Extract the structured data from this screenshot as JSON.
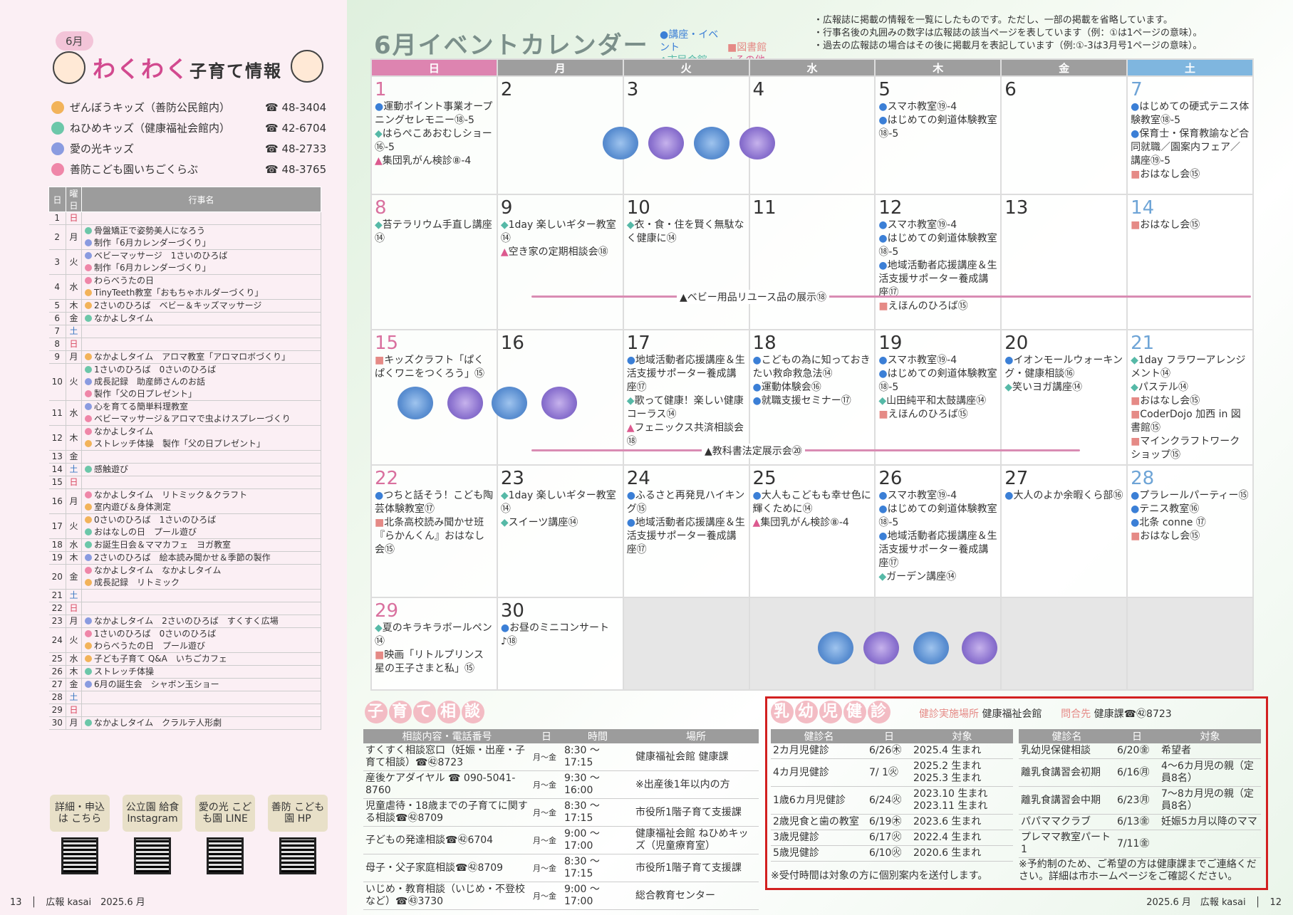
{
  "left": {
    "month_tag": "6月",
    "title_main": "わくわく",
    "title_sub": "子育て情報",
    "kids": [
      {
        "name": "ぜんぼうキッズ（善防公民館内）",
        "tel": "☎ 48-3404",
        "color": "#f2b35a"
      },
      {
        "name": "ねひめキッズ（健康福祉会館内）",
        "tel": "☎ 42-6704",
        "color": "#6cc7a9"
      },
      {
        "name": "愛の光キッズ",
        "tel": "☎ 48-2733",
        "color": "#8a9be0"
      },
      {
        "name": "善防こども園いちごくらぶ",
        "tel": "☎ 48-3765",
        "color": "#ef86a8"
      }
    ],
    "table_headers": [
      "日",
      "曜日",
      "行事名"
    ],
    "events": [
      {
        "d": "1",
        "w": "日",
        "n": ""
      },
      {
        "d": "2",
        "w": "月",
        "n": "骨盤矯正で姿勢美人になろう／制作「6月カレンダーづくり」"
      },
      {
        "d": "3",
        "w": "火",
        "n": "ベビーマッサージ　1さいのひろば／制作「6月カレンダーづくり」"
      },
      {
        "d": "4",
        "w": "水",
        "n": "わらべうたの日／TinyTeeth教室「おもちゃホルダーづくり」"
      },
      {
        "d": "5",
        "w": "木",
        "n": "2さいのひろば　ベビー＆キッズマッサージ"
      },
      {
        "d": "6",
        "w": "金",
        "n": "なかよしタイム"
      },
      {
        "d": "7",
        "w": "土",
        "n": ""
      },
      {
        "d": "8",
        "w": "日",
        "n": ""
      },
      {
        "d": "9",
        "w": "月",
        "n": "なかよしタイム　アロマ教室「アロマロボづくり」"
      },
      {
        "d": "10",
        "w": "火",
        "n": "1さいのひろば　0さいのひろば／成長記録　助産師さんのお話／製作「父の日プレゼント」"
      },
      {
        "d": "11",
        "w": "水",
        "n": "心を育てる簡単料理教室／ベビーマッサージ＆アロマで虫よけスプレーづくり"
      },
      {
        "d": "12",
        "w": "木",
        "n": "なかよしタイム／ストレッチ体操　製作「父の日プレゼント」"
      },
      {
        "d": "13",
        "w": "金",
        "n": ""
      },
      {
        "d": "14",
        "w": "土",
        "n": "感触遊び"
      },
      {
        "d": "15",
        "w": "日",
        "n": ""
      },
      {
        "d": "16",
        "w": "月",
        "n": "なかよしタイム　リトミック＆クラフト／室内遊び＆身体測定"
      },
      {
        "d": "17",
        "w": "火",
        "n": "0さいのひろば　1さいのひろば／おはなしの日　プール遊び"
      },
      {
        "d": "18",
        "w": "水",
        "n": "お誕生日会＆ママカフェ　ヨガ教室"
      },
      {
        "d": "19",
        "w": "木",
        "n": "2さいのひろば　絵本読み聞かせ＆季節の製作"
      },
      {
        "d": "20",
        "w": "金",
        "n": "なかよしタイム　なかよしタイム／成長記録　リトミック"
      },
      {
        "d": "21",
        "w": "土",
        "n": ""
      },
      {
        "d": "22",
        "w": "日",
        "n": ""
      },
      {
        "d": "23",
        "w": "月",
        "n": "なかよしタイム　2さいのひろば　すくすく広場"
      },
      {
        "d": "24",
        "w": "火",
        "n": "1さいのひろば　0さいのひろば／わらべうたの日　プール遊び"
      },
      {
        "d": "25",
        "w": "水",
        "n": "子ども子育て Q&A　いちごカフェ"
      },
      {
        "d": "26",
        "w": "木",
        "n": "ストレッチ体操"
      },
      {
        "d": "27",
        "w": "金",
        "n": "6月の誕生会　シャボン玉ショー"
      },
      {
        "d": "28",
        "w": "土",
        "n": ""
      },
      {
        "d": "29",
        "w": "日",
        "n": ""
      },
      {
        "d": "30",
        "w": "月",
        "n": "なかよしタイム　クラルテ人形劇"
      }
    ],
    "qr": [
      {
        "label": "詳細・申込は こちら"
      },
      {
        "label": "公立園 給食 Instagram"
      },
      {
        "label": "愛の光 こども園 LINE"
      },
      {
        "label": "善防 こども園 HP"
      }
    ],
    "footer": "13　│　広報 kasai　2025.6 月"
  },
  "calendar": {
    "title": "6月イベントカレンダー",
    "legend": [
      "●講座・イベント",
      "■図書館",
      "◆市民会館",
      "▲その他"
    ],
    "notes": [
      "・広報誌に掲載の情報を一覧にしたものです。ただし、一部の掲載を省略しています。",
      "・行事名後の丸囲みの数字は広報誌の該当ページを表しています（例：①は1ページの意味）。",
      "・過去の広報誌の場合はその後に掲載月を表記しています（例:①-3は3月号1ページの意味）。"
    ],
    "weekdays": [
      "日",
      "月",
      "火",
      "水",
      "木",
      "金",
      "土"
    ],
    "weeks": [
      [
        {
          "n": "1",
          "items": [
            [
              "●",
              "運動ポイント事業オープニングセレモニー⑱-5"
            ],
            [
              "◆",
              "はらぺこあおむしショー⑯-5"
            ],
            [
              "▲",
              "集団乳がん検診⑧-4"
            ]
          ]
        },
        {
          "n": "2",
          "items": []
        },
        {
          "n": "3",
          "items": []
        },
        {
          "n": "4",
          "items": []
        },
        {
          "n": "5",
          "items": [
            [
              "●",
              "スマホ教室⑲-4"
            ],
            [
              "●",
              "はじめての剣道体験教室⑱-5"
            ]
          ]
        },
        {
          "n": "6",
          "items": []
        },
        {
          "n": "7",
          "items": [
            [
              "●",
              "はじめての硬式テニス体験教室⑱-5"
            ],
            [
              "●",
              "保育士・保育教諭など合同就職／園案内フェア／講座⑲-5"
            ],
            [
              "■",
              "おはなし会⑮"
            ]
          ]
        }
      ],
      [
        {
          "n": "8",
          "items": [
            [
              "◆",
              "苔テラリウム手直し講座⑭"
            ]
          ]
        },
        {
          "n": "9",
          "items": [
            [
              "◆",
              "1day 楽しいギター教室⑭"
            ],
            [
              "▲",
              "空き家の定期相談会⑱"
            ]
          ]
        },
        {
          "n": "10",
          "items": [
            [
              "◆",
              "衣・食・住を賢く無駄なく健康に⑭"
            ]
          ]
        },
        {
          "n": "11",
          "items": []
        },
        {
          "n": "12",
          "items": [
            [
              "●",
              "スマホ教室⑲-4"
            ],
            [
              "●",
              "はじめての剣道体験教室⑱-5"
            ],
            [
              "●",
              "地域活動者応援講座＆生活支援サポーター養成講座⑰"
            ],
            [
              "■",
              "えほんのひろば⑮"
            ]
          ]
        },
        {
          "n": "13",
          "items": []
        },
        {
          "n": "14",
          "items": [
            [
              "■",
              "おはなし会⑮"
            ]
          ]
        }
      ],
      [
        {
          "n": "15",
          "items": [
            [
              "■",
              "キッズクラフト「ぱくぱくワニをつくろう」⑮"
            ]
          ]
        },
        {
          "n": "16",
          "items": []
        },
        {
          "n": "17",
          "items": [
            [
              "●",
              "地域活動者応援講座＆生活支援サポーター養成講座⑰"
            ],
            [
              "◆",
              "歌って健康！楽しい健康コーラス⑭"
            ],
            [
              "▲",
              "フェニックス共済相談会⑱"
            ]
          ]
        },
        {
          "n": "18",
          "items": [
            [
              "●",
              "こどもの為に知っておきたい救命救急法⑭"
            ],
            [
              "●",
              "運動体験会⑯"
            ],
            [
              "●",
              "就職支援セミナー⑰"
            ]
          ]
        },
        {
          "n": "19",
          "items": [
            [
              "●",
              "スマホ教室⑲-4"
            ],
            [
              "●",
              "はじめての剣道体験教室⑱-5"
            ],
            [
              "◆",
              "山田純平和太鼓講座⑭"
            ],
            [
              "■",
              "えほんのひろば⑮"
            ]
          ]
        },
        {
          "n": "20",
          "items": [
            [
              "●",
              "イオンモールウォーキング・健康相談⑯"
            ],
            [
              "◆",
              "笑いヨガ講座⑭"
            ]
          ]
        },
        {
          "n": "21",
          "items": [
            [
              "◆",
              "1day フラワーアレンジメント⑭"
            ],
            [
              "◆",
              "パステル⑭"
            ],
            [
              "■",
              "おはなし会⑮"
            ],
            [
              "■",
              "CoderDojo 加西 in 図書館⑮"
            ],
            [
              "■",
              "マインクラフトワークショップ⑮"
            ]
          ]
        }
      ],
      [
        {
          "n": "22",
          "items": [
            [
              "●",
              "つちと話そう！こども陶芸体験教室⑰"
            ],
            [
              "■",
              "北条高校読み聞かせ班『らかんくん』おはなし会⑮"
            ]
          ]
        },
        {
          "n": "23",
          "items": [
            [
              "◆",
              "1day 楽しいギター教室⑭"
            ],
            [
              "◆",
              "スイーツ講座⑭"
            ]
          ]
        },
        {
          "n": "24",
          "items": [
            [
              "●",
              "ふるさと再発見ハイキング⑮"
            ],
            [
              "●",
              "地域活動者応援講座＆生活支援サポーター養成講座⑰"
            ]
          ]
        },
        {
          "n": "25",
          "items": [
            [
              "●",
              "大人もこどもも幸せ色に輝くために⑭"
            ],
            [
              "▲",
              "集団乳がん検診⑧-4"
            ]
          ]
        },
        {
          "n": "26",
          "items": [
            [
              "●",
              "スマホ教室⑲-4"
            ],
            [
              "●",
              "はじめての剣道体験教室⑱-5"
            ],
            [
              "●",
              "地域活動者応援講座＆生活支援サポーター養成講座⑰"
            ],
            [
              "◆",
              "ガーデン講座⑭"
            ]
          ]
        },
        {
          "n": "27",
          "items": [
            [
              "●",
              "大人のよか余暇くら部⑯"
            ]
          ]
        },
        {
          "n": "28",
          "items": [
            [
              "●",
              "プラレールパーティー⑮"
            ],
            [
              "●",
              "テニス教室⑯"
            ],
            [
              "●",
              "北条 conne ⑰"
            ],
            [
              "■",
              "おはなし会⑮"
            ]
          ]
        }
      ],
      [
        {
          "n": "29",
          "items": [
            [
              "◆",
              "夏のキラキラボールペン⑭"
            ],
            [
              "■",
              "映画「リトルプリンス　星の王子さまと私」⑮"
            ]
          ]
        },
        {
          "n": "30",
          "items": [
            [
              "●",
              "お昼のミニコンサート♪⑱"
            ]
          ]
        },
        {
          "n": "",
          "items": [],
          "gray": true
        },
        {
          "n": "",
          "items": [],
          "gray": true
        },
        {
          "n": "",
          "items": [],
          "gray": true
        },
        {
          "n": "",
          "items": [],
          "gray": true
        },
        {
          "n": "",
          "items": [],
          "gray": true
        }
      ]
    ],
    "band1": "▲ベビー用品リユース品の展示⑱",
    "band2": "▲教科書法定展示会⑳"
  },
  "consult": {
    "title": [
      "子",
      "育",
      "て",
      "相",
      "談"
    ],
    "headers": [
      "相談内容・電話番号",
      "日",
      "時間",
      "場所"
    ],
    "rows": [
      [
        "すくすく相談窓口（妊娠・出産・子育て相談）☎㊷8723",
        "月〜金",
        "8:30 〜 17:15",
        "健康福祉会館 健康課"
      ],
      [
        "産後ケアダイヤル ☎ 090-5041-8760",
        "月〜金",
        "9:30 〜 16:00",
        "※出産後1年以内の方"
      ],
      [
        "児童虐待・18歳までの子育てに関する相談☎㊷8709",
        "月〜金",
        "8:30 〜 17:15",
        "市役所1階子育て支援課"
      ],
      [
        "子どもの発達相談☎㊷6704",
        "月〜金",
        "9:00 〜 17:00",
        "健康福祉会館 ねひめキッズ（児童療育室）"
      ],
      [
        "母子・父子家庭相談☎㊷8709",
        "月〜金",
        "8:30 〜 17:15",
        "市役所1階子育て支援課"
      ],
      [
        "いじめ・教育相談（いじめ・不登校など）☎㊸3730",
        "月〜金",
        "9:00 〜 17:00",
        "総合教育センター"
      ]
    ]
  },
  "health": {
    "title": [
      "乳",
      "幼",
      "児",
      "健",
      "診"
    ],
    "place_label": "健診実施場所",
    "place": "健康福祉会館",
    "contact_label": "問合先",
    "contact": "健康課☎㊷8723",
    "headers1": [
      "健診名",
      "日",
      "対象"
    ],
    "rows1": [
      [
        "2カ月児健診",
        "6/26㊍",
        "2025.4 生まれ"
      ],
      [
        "4カ月児健診",
        "7/ 1㊋",
        "2025.2 生まれ／2025.3 生まれ"
      ],
      [
        "1歳6カ月児健診",
        "6/24㊋",
        "2023.10 生まれ／2023.11 生まれ"
      ],
      [
        "2歳児食と歯の教室",
        "6/19㊍",
        "2023.6 生まれ"
      ],
      [
        "3歳児健診",
        "6/17㊋",
        "2022.4 生まれ"
      ],
      [
        "5歳児健診",
        "6/10㊋",
        "2020.6 生まれ"
      ]
    ],
    "headers2": [
      "健診名",
      "日",
      "対象"
    ],
    "rows2": [
      [
        "乳幼児保健相談",
        "6/20㊎",
        "希望者"
      ],
      [
        "離乳食講習会初期",
        "6/16㊊",
        "4〜6カ月児の親（定員8名）"
      ],
      [
        "離乳食講習会中期",
        "6/23㊊",
        "7〜8カ月児の親（定員8名）"
      ],
      [
        "パパママクラブ",
        "6/13㊎",
        "妊娠5カ月以降のママ"
      ],
      [
        "プレママ教室パート1",
        "7/11㊎",
        ""
      ]
    ],
    "note1": "※受付時間は対象の方に個別案内を送付します。",
    "note2": "※予約制のため、ご希望の方は健康課までご連絡ください。詳細は市ホームページをご確認ください。"
  },
  "footer_right": "2025.6 月　広報 kasai　│　12"
}
